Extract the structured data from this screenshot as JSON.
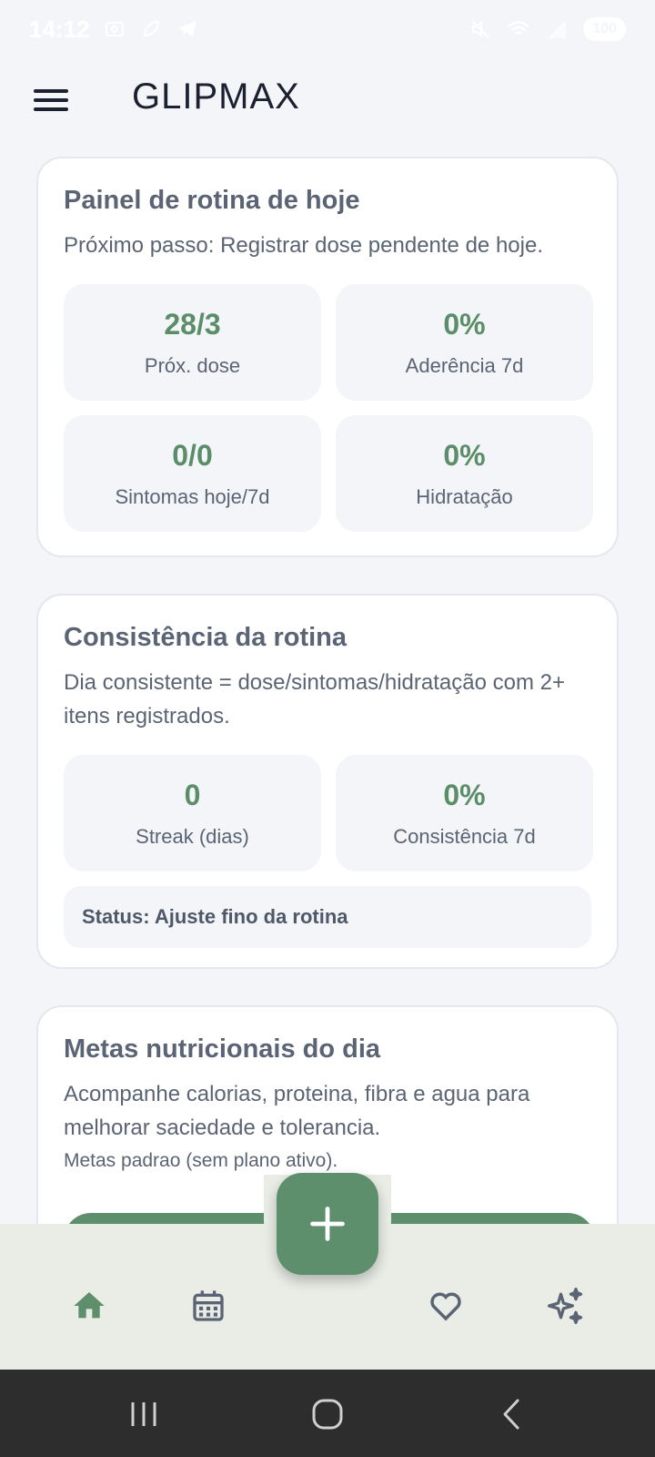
{
  "status_bar": {
    "time": "14:12",
    "battery": "100"
  },
  "app_bar": {
    "title": "GLIPMAX"
  },
  "routine_card": {
    "title": "Painel de rotina de hoje",
    "description": "Próximo passo: Registrar dose pendente de hoje.",
    "stats": [
      {
        "value": "28/3",
        "label": "Próx. dose"
      },
      {
        "value": "0%",
        "label": "Aderência 7d"
      },
      {
        "value": "0/0",
        "label": "Sintomas hoje/7d"
      },
      {
        "value": "0%",
        "label": "Hidratação"
      }
    ]
  },
  "consistency_card": {
    "title": "Consistência da rotina",
    "description": "Dia consistente = dose/sintomas/hidratação com 2+ itens registrados.",
    "stats": [
      {
        "value": "0",
        "label": "Streak (dias)"
      },
      {
        "value": "0%",
        "label": "Consistência 7d"
      }
    ],
    "status": "Status: Ajuste fino da rotina"
  },
  "nutrition_card": {
    "title": "Metas nutricionais do dia",
    "description": "Acompanhe calorias, proteina, fibra e agua para melhorar saciedade e tolerancia.",
    "note": "Metas padrao (sem plano ativo)."
  },
  "colors": {
    "accent": "#5e8f6c",
    "accent_text": "#5a8d68",
    "background": "#f3f5f9",
    "nav_background": "#e9ede6",
    "system_nav": "#2d2d2d"
  },
  "icons": {
    "menu": "hamburger-icon",
    "home": "home-icon",
    "calendar": "calendar-icon",
    "favorite": "heart-icon",
    "ai": "sparkles-icon",
    "add": "plus-icon"
  }
}
